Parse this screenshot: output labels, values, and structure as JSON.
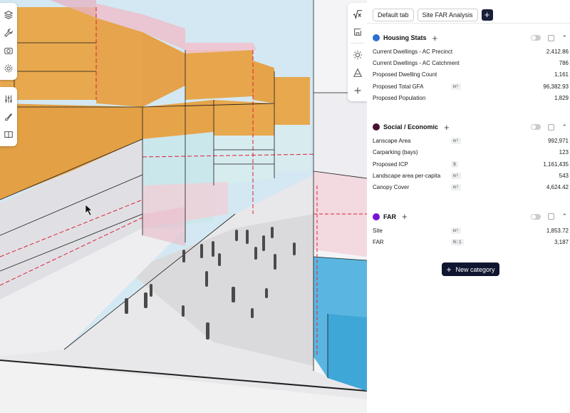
{
  "tabs": [
    "Default tab",
    "Site FAR Analysis"
  ],
  "tab_add_label": "+",
  "left_toolbar": {
    "group1": [
      "layers-icon",
      "wrench-icon",
      "camera-icon",
      "settings-icon"
    ],
    "group2": [
      "sliders-icon",
      "brush-icon",
      "book-icon"
    ]
  },
  "mid_toolbar": [
    "formula-icon",
    "grid-view-icon",
    "sun-icon",
    "triangle-icon",
    "plus-icon"
  ],
  "categories": [
    {
      "name": "Housing Stats",
      "color": "#2e6fd1",
      "rows": [
        {
          "label": "Current Dwellings - AC Precinct",
          "unit": "",
          "value": "2,412.86"
        },
        {
          "label": "Current Dwellings - AC Catchment",
          "unit": "",
          "value": "786"
        },
        {
          "label": "Proposed Dwelling Count",
          "unit": "",
          "value": "1,161"
        },
        {
          "label": "Proposed Total GFA",
          "unit": "m²",
          "value": "96,382.93"
        },
        {
          "label": "Proposed Population",
          "unit": "",
          "value": "1,829"
        }
      ]
    },
    {
      "name": "Social / Economic",
      "color": "#4a1030",
      "rows": [
        {
          "label": "Lanscape Area",
          "unit": "m²",
          "value": "992,971"
        },
        {
          "label": "Carparking (bays)",
          "unit": "",
          "value": "123"
        },
        {
          "label": "Proposed ICP",
          "unit": "$",
          "value": "1,161,435"
        },
        {
          "label": "Landscape area per-capita",
          "unit": "m²",
          "value": "543"
        },
        {
          "label": "Canopy Cover",
          "unit": "m²",
          "value": "4,624.42"
        }
      ]
    },
    {
      "name": "FAR",
      "color": "#7a12d6",
      "rows": [
        {
          "label": "Site",
          "unit": "m²",
          "value": "1,853.72"
        },
        {
          "label": "FAR",
          "unit": "N:1",
          "value": "3,187"
        }
      ]
    }
  ],
  "new_category_label": "New category"
}
